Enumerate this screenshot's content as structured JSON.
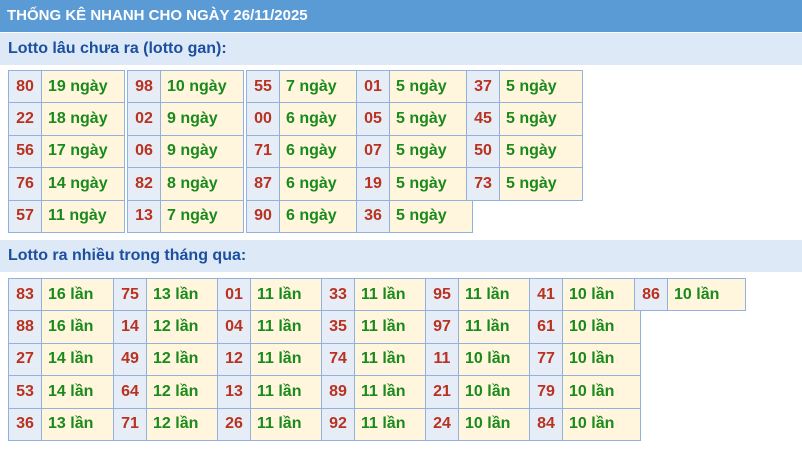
{
  "title": "THỐNG KÊ NHANH CHO NGÀY 26/11/2025",
  "section_gan": {
    "label": "Lotto lâu chưa ra (lotto gan):",
    "groups": [
      [
        {
          "num": "80",
          "val": "19 ngày"
        },
        {
          "num": "22",
          "val": "18 ngày"
        },
        {
          "num": "56",
          "val": "17 ngày"
        },
        {
          "num": "76",
          "val": "14 ngày"
        },
        {
          "num": "57",
          "val": "11 ngày"
        }
      ],
      [
        {
          "num": "98",
          "val": "10 ngày"
        },
        {
          "num": "02",
          "val": "9 ngày"
        },
        {
          "num": "06",
          "val": "9 ngày"
        },
        {
          "num": "82",
          "val": "8 ngày"
        },
        {
          "num": "13",
          "val": "7 ngày"
        }
      ],
      [
        {
          "num": "55",
          "val": "7 ngày"
        },
        {
          "num": "00",
          "val": "6 ngày"
        },
        {
          "num": "71",
          "val": "6 ngày"
        },
        {
          "num": "87",
          "val": "6 ngày"
        },
        {
          "num": "90",
          "val": "6 ngày"
        }
      ],
      [
        {
          "num": "01",
          "val": "5 ngày"
        },
        {
          "num": "05",
          "val": "5 ngày"
        },
        {
          "num": "07",
          "val": "5 ngày"
        },
        {
          "num": "19",
          "val": "5 ngày"
        },
        {
          "num": "36",
          "val": "5 ngày"
        }
      ],
      [
        {
          "num": "37",
          "val": "5 ngày"
        },
        {
          "num": "45",
          "val": "5 ngày"
        },
        {
          "num": "50",
          "val": "5 ngày"
        },
        {
          "num": "73",
          "val": "5 ngày"
        }
      ]
    ]
  },
  "section_frequent": {
    "label": "Lotto ra nhiều trong tháng qua:",
    "groups": [
      [
        {
          "num": "83",
          "val": "16 lần"
        },
        {
          "num": "88",
          "val": "16 lần"
        },
        {
          "num": "27",
          "val": "14 lần"
        },
        {
          "num": "53",
          "val": "14 lần"
        },
        {
          "num": "36",
          "val": "13 lần"
        }
      ],
      [
        {
          "num": "75",
          "val": "13 lần"
        },
        {
          "num": "14",
          "val": "12 lần"
        },
        {
          "num": "49",
          "val": "12 lần"
        },
        {
          "num": "64",
          "val": "12 lần"
        },
        {
          "num": "71",
          "val": "12 lần"
        }
      ],
      [
        {
          "num": "01",
          "val": "11 lần"
        },
        {
          "num": "04",
          "val": "11 lần"
        },
        {
          "num": "12",
          "val": "11 lần"
        },
        {
          "num": "13",
          "val": "11 lần"
        },
        {
          "num": "26",
          "val": "11 lần"
        }
      ],
      [
        {
          "num": "33",
          "val": "11 lần"
        },
        {
          "num": "35",
          "val": "11 lần"
        },
        {
          "num": "74",
          "val": "11 lần"
        },
        {
          "num": "89",
          "val": "11 lần"
        },
        {
          "num": "92",
          "val": "11 lần"
        }
      ],
      [
        {
          "num": "95",
          "val": "11 lần"
        },
        {
          "num": "97",
          "val": "11 lần"
        },
        {
          "num": "11",
          "val": "10 lần"
        },
        {
          "num": "21",
          "val": "10 lần"
        },
        {
          "num": "24",
          "val": "10 lần"
        }
      ],
      [
        {
          "num": "41",
          "val": "10 lần"
        },
        {
          "num": "61",
          "val": "10 lần"
        },
        {
          "num": "77",
          "val": "10 lần"
        },
        {
          "num": "79",
          "val": "10 lần"
        },
        {
          "num": "84",
          "val": "10 lần"
        }
      ],
      [
        {
          "num": "86",
          "val": "10 lần"
        }
      ]
    ]
  },
  "colors": {
    "title_bg": "#5b9bd5",
    "section_bg": "#dde9f6",
    "number_text": "#b8321f",
    "value_text": "#198a1b",
    "cell_border": "#8fb2de"
  }
}
